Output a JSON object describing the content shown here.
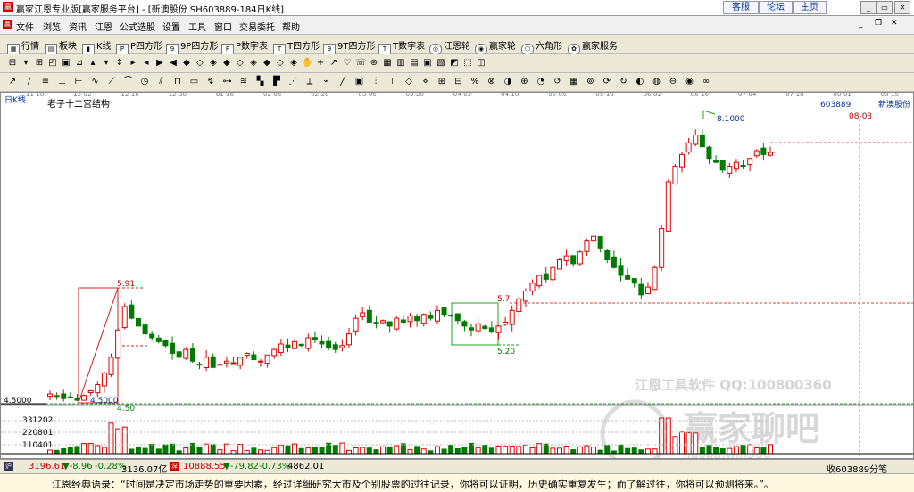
{
  "window": {
    "title": "赢家江恩专业版[赢家服务平台] - [新澳股份  SH603889-184日K线]",
    "top_links": [
      "客服",
      "论坛",
      "主页"
    ]
  },
  "menu": [
    "文件",
    "浏览",
    "资讯",
    "江恩",
    "公式选股",
    "设置",
    "工具",
    "窗口",
    "交易委托",
    "帮助"
  ],
  "toolbar": [
    "行情",
    "板块",
    "K线",
    "P四方形",
    "9P四方形",
    "P数字表",
    "T四方形",
    "9T四方形",
    "T数字表",
    "江恩轮",
    "赢家轮",
    "六角形",
    "赢家服务"
  ],
  "chart": {
    "period_label": "日K线",
    "structure_label": "老子十二宫结构",
    "stock_code": "603889",
    "stock_name": "新澳股份",
    "date_marker": "08-03",
    "date_axis": [
      "11-18",
      "12-02",
      "12-16",
      "12-30",
      "01-16",
      "02-06",
      "02-20",
      "03-06",
      "03-20",
      "04-03",
      "04-18",
      "05-05",
      "05-19",
      "06-02",
      "06-16",
      "07-04",
      "07-18",
      "08-01",
      "08-15"
    ],
    "price_labels": {
      "high": "8.1000",
      "p591": "5.91",
      "p57": "5.7",
      "p520": "5.20",
      "low": "4.5000",
      "low_axis": "4.5000",
      "p450": "4.50"
    },
    "volume_ticks": [
      "331202",
      "220801",
      "110401"
    ],
    "watermark": [
      "江恩工具软件  QQ:100800360",
      "赢家聊吧",
      "liaoba.win360"
    ],
    "high_value": 8.1,
    "low_value": 4.5
  },
  "chart_data": {
    "type": "candlestick",
    "title": "新澳股份 SH603889 日K线",
    "closes": [
      4.58,
      4.55,
      4.52,
      4.54,
      4.5,
      4.56,
      4.62,
      4.7,
      4.85,
      5.05,
      5.4,
      5.7,
      5.55,
      5.45,
      5.35,
      5.3,
      5.25,
      5.2,
      5.1,
      5.05,
      5.15,
      5.0,
      4.95,
      5.05,
      4.92,
      4.96,
      5.0,
      4.98,
      5.05,
      5.1,
      5.02,
      5.0,
      5.08,
      5.15,
      5.22,
      5.18,
      5.25,
      5.2,
      5.3,
      5.28,
      5.22,
      5.18,
      5.15,
      5.2,
      5.35,
      5.55,
      5.62,
      5.5,
      5.48,
      5.52,
      5.45,
      5.55,
      5.5,
      5.58,
      5.52,
      5.6,
      5.55,
      5.65,
      5.6,
      5.58,
      5.52,
      5.45,
      5.4,
      5.48,
      5.42,
      5.38,
      5.45,
      5.5,
      5.65,
      5.8,
      5.9,
      6.0,
      6.1,
      6.05,
      6.2,
      6.3,
      6.35,
      6.25,
      6.4,
      6.55,
      6.6,
      6.45,
      6.3,
      6.2,
      6.1,
      6.05,
      6.0,
      5.85,
      5.95,
      6.2,
      6.7,
      7.3,
      7.5,
      7.65,
      7.8,
      7.9,
      7.75,
      7.6,
      7.55,
      7.45,
      7.5,
      7.55,
      7.5,
      7.6,
      7.7,
      7.65,
      7.68
    ],
    "volume_ticks": [
      "331202",
      "220801",
      "110401"
    ],
    "annotations": [
      "8.1000",
      "5.91",
      "5.7",
      "5.20",
      "4.5000",
      "4.50"
    ]
  },
  "status": {
    "sh_index": "3196.61",
    "sh_change": "▼-8.96",
    "sh_pct": "-0.28%",
    "sh_amount": "3136.07亿",
    "sz_index": "10888.55",
    "sz_change": "▼-79.82",
    "sz_pct": "-0.73%",
    "sz_amount": "4862.01",
    "right_text": "收603889分笔"
  },
  "quote": "江恩经典语录：“时间是决定市场走势的重要因素，经过详细研究大市及个别股票的过往记录，你将可以证明，历史确实重复发生；而了解过往，你将可以预测将来。”。",
  "colors": {
    "up": "#e00000",
    "down": "#007a00",
    "accent": "#003399"
  }
}
